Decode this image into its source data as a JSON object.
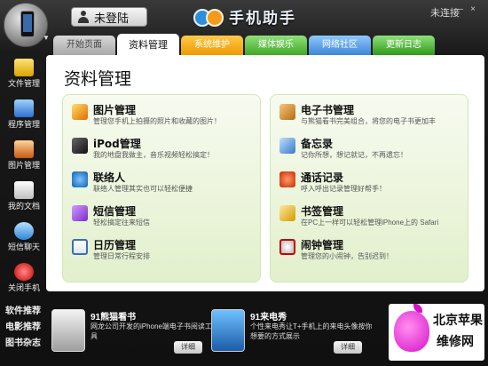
{
  "titlebar": {
    "login": "未登陆",
    "app_name": "手机助手",
    "connection_status": "未连接",
    "window_buttons": [
      "—",
      "×"
    ]
  },
  "tabs": [
    {
      "label": "开始页面",
      "active": false
    },
    {
      "label": "资料管理",
      "active": true
    },
    {
      "label": "系统维护",
      "active": false
    },
    {
      "label": "媒体娱乐",
      "active": false
    },
    {
      "label": "网络社区",
      "active": false
    },
    {
      "label": "更新日志",
      "active": false
    }
  ],
  "sidebar": {
    "items": [
      {
        "label": "文件管理",
        "icon": "folder-icon"
      },
      {
        "label": "程序管理",
        "icon": "apps-icon"
      },
      {
        "label": "图片管理",
        "icon": "picture-icon"
      },
      {
        "label": "我的文档",
        "icon": "document-icon"
      },
      {
        "label": "短信聊天",
        "icon": "chat-icon"
      },
      {
        "label": "关闭手机",
        "icon": "power-icon"
      }
    ]
  },
  "main": {
    "title": "资料管理",
    "left_features": [
      {
        "title": "图片管理",
        "desc": "管理您手机上拍摄的照片和收藏的图片！",
        "icon": "pictures-icon"
      },
      {
        "title": "iPod管理",
        "desc": "我的地盘我做主，音乐视频轻松搞定！",
        "icon": "ipod-icon"
      },
      {
        "title": "联络人",
        "desc": "联络人管理其实也可以轻松便捷",
        "icon": "contacts-icon"
      },
      {
        "title": "短信管理",
        "desc": "轻松搞定往来短信",
        "icon": "sms-icon"
      },
      {
        "title": "日历管理",
        "desc": "管理日常行程安排",
        "icon": "calendar-icon"
      }
    ],
    "right_features": [
      {
        "title": "电子书管理",
        "desc": "与熊猫看书完美组合，将您的电子书更加丰",
        "icon": "ebook-icon"
      },
      {
        "title": "备忘录",
        "desc": "记你所想，想记就记，不再遗忘！",
        "icon": "memo-icon"
      },
      {
        "title": "通话记录",
        "desc": "呼入呼出记录管理好帮手！",
        "icon": "call-log-icon"
      },
      {
        "title": "书签管理",
        "desc": "在PC上一样可以轻松管理iPhone上的 Safari",
        "icon": "bookmark-icon"
      },
      {
        "title": "闹钟管理",
        "desc": "管理您的小闹钟，告别迟到！",
        "icon": "alarm-icon"
      }
    ]
  },
  "bottom": {
    "links": [
      "软件推荐",
      "电影推荐",
      "图书杂志"
    ],
    "promos": [
      {
        "name": "91熊猫看书",
        "desc": "网龙公司开发的iPhone端电子书阅读工具",
        "button": "详细",
        "icon": "panda-reader-icon"
      },
      {
        "name": "91来电秀",
        "desc": "个性来电秀让T+手机上的来电头像按你想要的方式展示",
        "button": "详细",
        "icon": "caller-show-icon"
      }
    ],
    "brand": {
      "line1": "北京苹果",
      "line2": "维修网"
    }
  }
}
